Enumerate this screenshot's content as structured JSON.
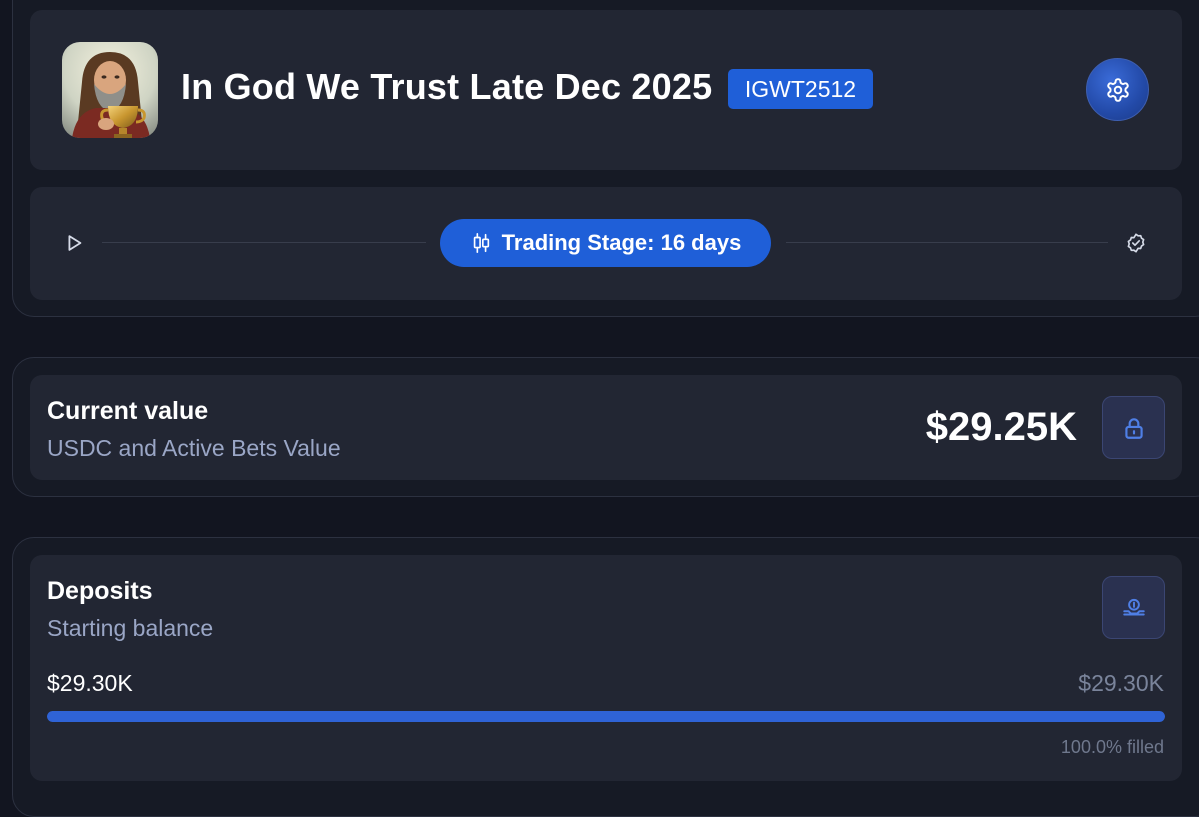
{
  "market": {
    "title": "In God We Trust Late Dec 2025",
    "ticker": "IGWT2512",
    "avatar_icon": "portrait-holding-trophy-icon",
    "settings_icon": "gear-icon"
  },
  "stage": {
    "start_icon": "play-icon",
    "label": "Trading Stage: 16 days",
    "label_icon": "candlestick-icon",
    "end_icon": "verified-check-icon"
  },
  "current_value": {
    "title": "Current value",
    "subtitle": "USDC and Active Bets Value",
    "amount": "$29.25K",
    "action_icon": "lock-icon"
  },
  "deposits": {
    "title": "Deposits",
    "subtitle": "Starting balance",
    "amount": "$29.30K",
    "cap": "$29.30K",
    "filled_label": "100.0% filled",
    "fill_fraction": 1.0,
    "action_icon": "coin-hand-icon"
  },
  "colors": {
    "accent": "#1f5fd8",
    "background": "#121520",
    "card": "#222633"
  }
}
